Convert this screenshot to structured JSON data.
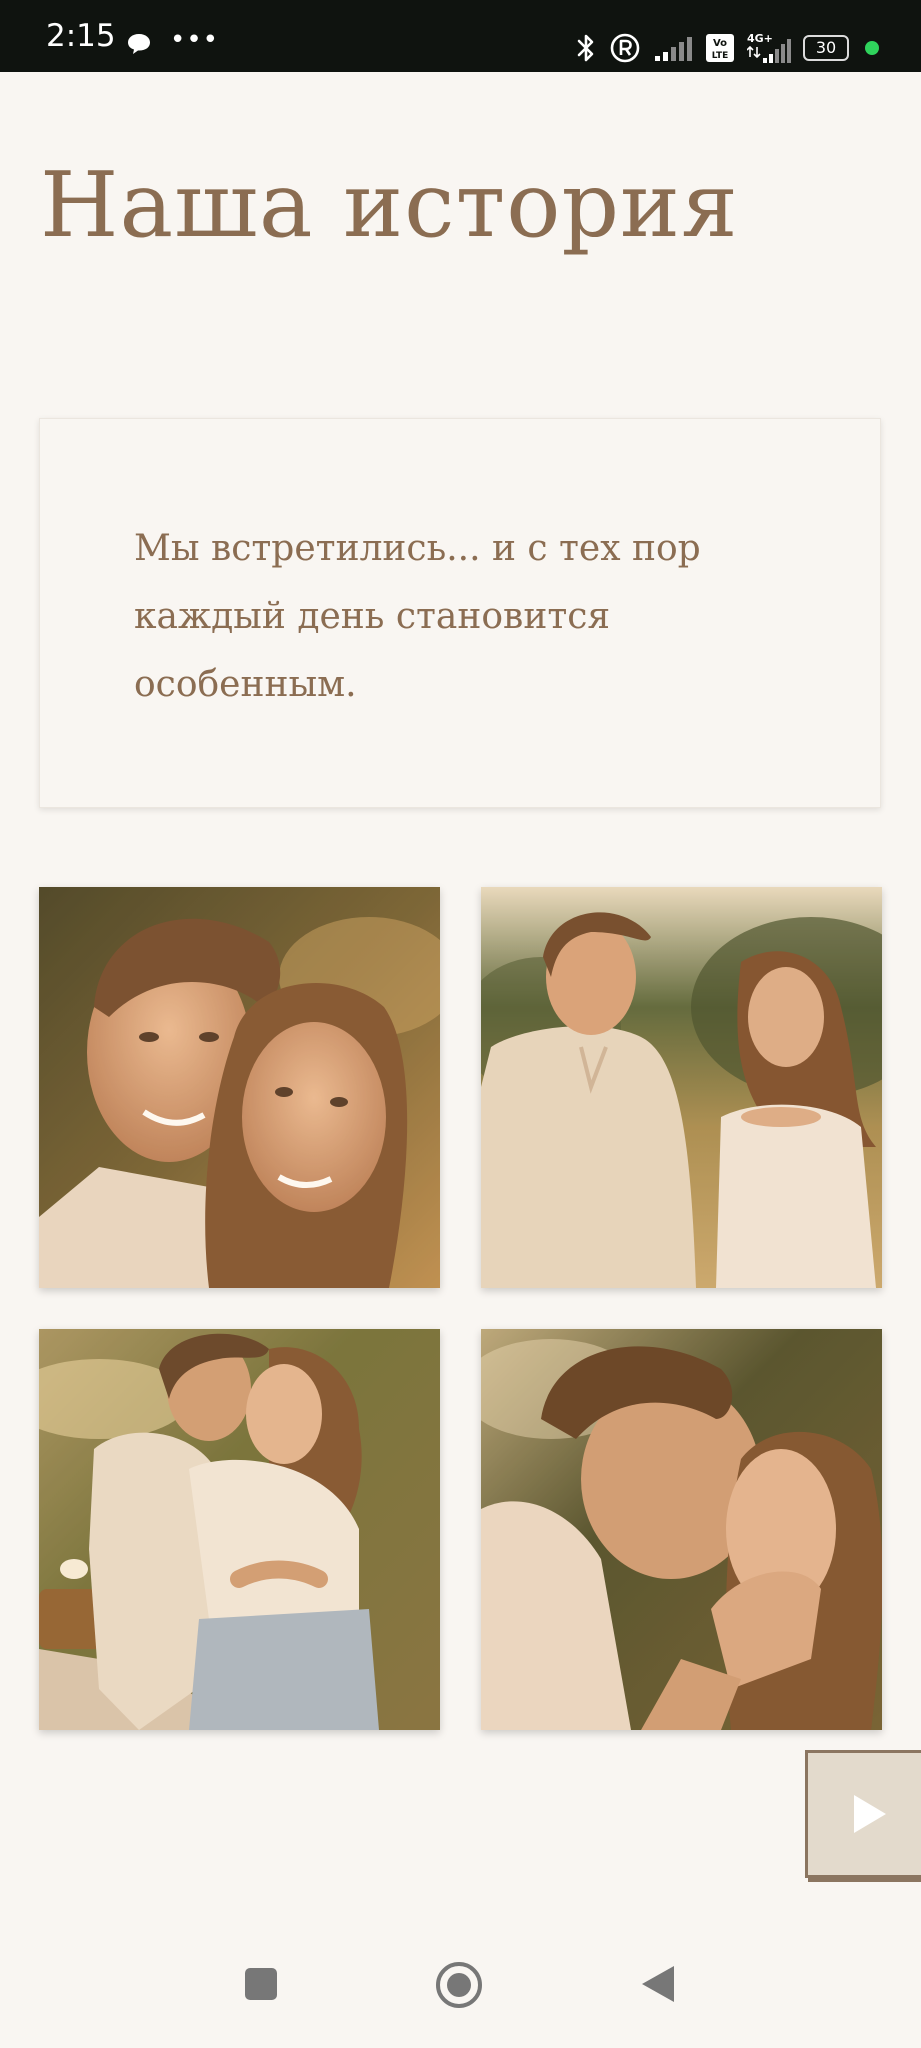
{
  "status_bar": {
    "time": "2:15",
    "dots": "•••",
    "battery": "30",
    "icons": [
      "chat-bubble-icon",
      "bluetooth-icon",
      "registered-icon",
      "signal-icon",
      "volte-icon",
      "4g-signal-icon",
      "battery-icon"
    ]
  },
  "page": {
    "title": "Наша история",
    "story_text": "Мы встретились... и с тех пор каждый день становится особенным."
  },
  "gallery": {
    "photos": [
      {
        "name": "couple-cheek-to-cheek"
      },
      {
        "name": "couple-standing-field"
      },
      {
        "name": "couple-picnic-embrace"
      },
      {
        "name": "couple-kiss"
      }
    ]
  },
  "controls": {
    "play_icon": "play-icon"
  },
  "nav": {
    "icons": [
      "recents-icon",
      "home-icon",
      "back-icon"
    ]
  },
  "colors": {
    "background": "#f9f6f2",
    "accent_text": "#8b6d52",
    "status_bar": "#0f130f"
  }
}
